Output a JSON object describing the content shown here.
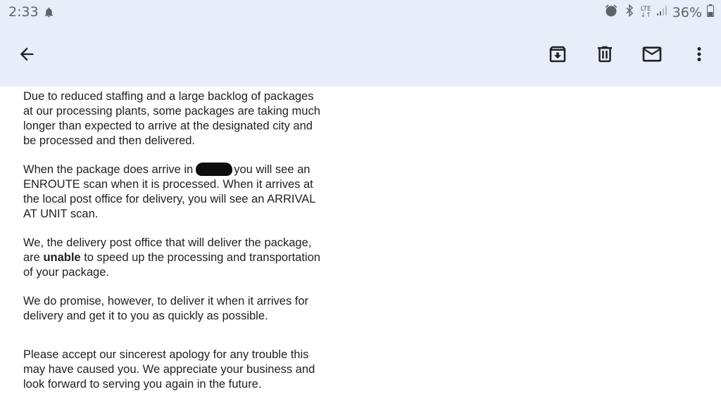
{
  "status_bar": {
    "time": "2:33",
    "network_label": "LTE",
    "battery_percent": "36%",
    "icons": [
      "bell-icon",
      "alarm-icon",
      "bluetooth-icon",
      "signal-icon",
      "battery-icon"
    ]
  },
  "toolbar": {
    "back_icon": "arrow-back-icon",
    "actions": [
      "archive-icon",
      "trash-icon",
      "mail-icon",
      "more-vert-icon"
    ]
  },
  "email": {
    "p1": "Due to reduced staffing and a large backlog of packages\nat our processing plants, some packages are taking much\nlonger than expected to arrive at the designated city and\nbe processed and then delivered.",
    "p2_before": "When the package does arrive in",
    "p2_after": "you will see an\nENROUTE scan when it is processed.  When it arrives at\nthe local post office for delivery, you will see an ARRIVAL\nAT UNIT scan.",
    "p3_before": "We, the delivery post office that will deliver the package,\nare ",
    "p3_bold": "unable",
    "p3_after": " to speed up the processing and transportation\nof your package.",
    "p4": "We do promise, however, to deliver it when it arrives for\ndelivery and get it to you as quickly as possible.",
    "p5": "Please accept our sincerest apology for any trouble this\nmay have caused you. We appreciate your business and\nlook forward to serving you again in the future."
  },
  "colors": {
    "header_bg": "#e8eef9",
    "icon": "#202124",
    "status_text": "#5f6368"
  }
}
